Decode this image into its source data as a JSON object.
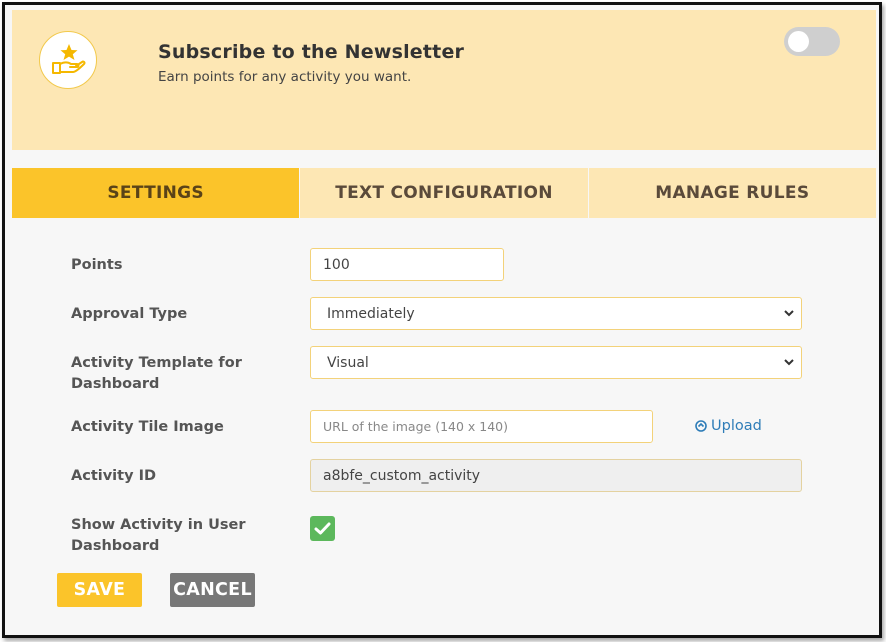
{
  "header": {
    "title": "Subscribe to the Newsletter",
    "subtitle": "Earn points for any activity you want.",
    "logo_icon": "hand-star-icon",
    "toggle_on": false
  },
  "tabs": [
    {
      "label": "SETTINGS",
      "active": true
    },
    {
      "label": "TEXT CONFIGURATION",
      "active": false
    },
    {
      "label": "MANAGE RULES",
      "active": false
    }
  ],
  "form": {
    "points": {
      "label": "Points",
      "value": "100"
    },
    "approval_type": {
      "label": "Approval Type",
      "value": "Immediately"
    },
    "activity_template": {
      "label": "Activity Template for Dashboard",
      "value": "Visual"
    },
    "tile_image": {
      "label": "Activity Tile Image",
      "placeholder": "URL of the image (140 x 140)",
      "upload_label": "Upload",
      "upload_icon": "upload-circle-icon"
    },
    "activity_id": {
      "label": "Activity ID",
      "value": "a8bfe_custom_activity"
    },
    "show_in_dashboard": {
      "label": "Show Activity in User Dashboard",
      "checked": true
    }
  },
  "actions": {
    "save_label": "SAVE",
    "cancel_label": "CANCEL"
  },
  "colors": {
    "accent": "#fbc42a",
    "header_bg": "#fde7b4",
    "check_green": "#5cb85c",
    "link_blue": "#2f7db8",
    "cancel_grey": "#777777"
  }
}
